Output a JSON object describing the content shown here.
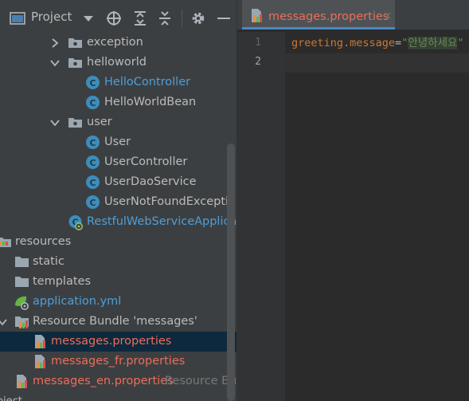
{
  "project": {
    "title": "Project",
    "header_icons": [
      "window-icon",
      "dropdown-icon",
      "locate-icon",
      "expand-all-icon",
      "collapse-all-icon",
      "gear-icon",
      "minimize-icon"
    ]
  },
  "tree": {
    "exception": "exception",
    "helloworld": "helloworld",
    "hello_controller": "HelloController",
    "hello_world_bean": "HelloWorldBean",
    "user": "user",
    "user_class": "User",
    "user_controller": "UserController",
    "user_dao_service": "UserDaoService",
    "user_not_found": "UserNotFoundException",
    "restful_app": "RestfulWebServiceApplication",
    "resources": "resources",
    "static": "static",
    "templates": "templates",
    "application_yml": "application.yml",
    "bundle": "Resource Bundle 'messages'",
    "messages_properties": "messages.properties",
    "messages_fr": "messages_fr.properties",
    "messages_en": "messages_en.properties",
    "messages_en_hint": "Resource Bundle 'messages'",
    "bottom_text": "oject"
  },
  "editor": {
    "tab_label": "messages.properties",
    "tab_close": "×",
    "line_numbers": [
      "1",
      "2"
    ],
    "code": {
      "key": "greeting.message",
      "eq": "=",
      "quote_open": "\"",
      "value": "안녕하세요",
      "quote_close": "\""
    }
  },
  "colors": {
    "blue_text": "#4e9ed9",
    "red_text": "#ec6d5a",
    "selection": "#0d293e",
    "accent": "#4a88c7"
  }
}
